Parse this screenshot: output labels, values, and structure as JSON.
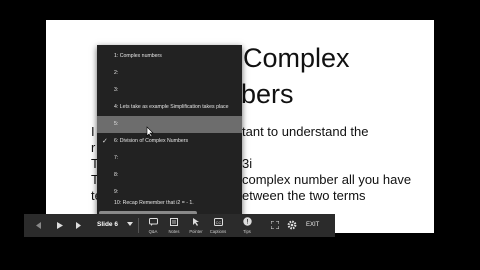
{
  "slide": {
    "title_line1": "Complex",
    "title_line2": "bers",
    "body_lines": [
      "tant to understand the",
      "3i",
      "complex number all you have",
      "etween the two terms"
    ],
    "left_fragments": [
      "I",
      "r",
      "T",
      "T",
      "te"
    ]
  },
  "menu": {
    "items": [
      {
        "label": "1: Complex numbers",
        "checked": false,
        "hover": false
      },
      {
        "label": "2:",
        "checked": false,
        "hover": false
      },
      {
        "label": "3:",
        "checked": false,
        "hover": false
      },
      {
        "label": "4: Lets take as example Simplification takes place",
        "checked": false,
        "hover": false
      },
      {
        "label": "5:",
        "checked": false,
        "hover": true
      },
      {
        "label": "6: Division of Complex Numbers",
        "checked": true,
        "hover": false
      },
      {
        "label": "7:",
        "checked": false,
        "hover": false
      },
      {
        "label": "8:",
        "checked": false,
        "hover": false
      },
      {
        "label": "9:",
        "checked": false,
        "hover": false
      },
      {
        "label": "10: Recap Remember that i2 = - 1.",
        "checked": false,
        "hover": false
      }
    ]
  },
  "toolbar": {
    "slide_selector": "Slide 6",
    "qa_label": "Q&A",
    "notes_label": "Notes",
    "pointer_label": "Pointer",
    "captions_label": "Captions",
    "tips_label": "Tips",
    "exit_label": "EXIT"
  },
  "colors": {
    "menu_bg": "#222222",
    "menu_hover": "#6d6d6d",
    "toolbar_bg": "#2b2b2b"
  }
}
